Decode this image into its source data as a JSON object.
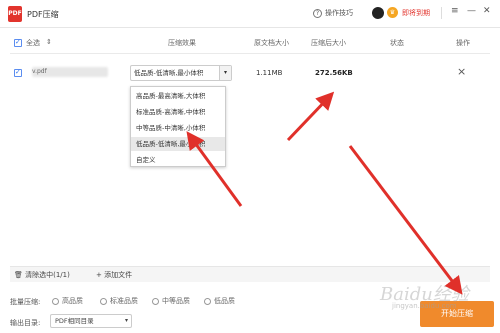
{
  "window": {
    "logo_text": "PDF",
    "title": "PDF压缩",
    "tips": "操作技巧",
    "expire": "即将到期",
    "menu_icon": "≡",
    "min_icon": "—",
    "close_icon": "✕"
  },
  "table": {
    "select_all": "全选",
    "sort_icon": "⇕",
    "headers": [
      "压缩效果",
      "原文档大小",
      "压缩后大小",
      "状态",
      "操作"
    ],
    "row": {
      "filename": "v.pdf",
      "compression": "低品质-低清晰,最小体积",
      "original_size": "1.11MB",
      "compressed_size": "272.56KB",
      "delete": "×"
    },
    "options": [
      "高品质-最高清晰,大体积",
      "标准品质-高清晰,中体积",
      "中等品质-中清晰,小体积",
      "低品质-低清晰,最小体积",
      "自定义"
    ]
  },
  "footer": {
    "clear": "清除选中(1/1)",
    "add": "添加文件"
  },
  "controls": {
    "batch_label": "批量压缩:",
    "radios": [
      "高品质",
      "标准品质",
      "中等品质",
      "低品质"
    ],
    "output_label": "输出目录:",
    "output_value": "PDF相同目录",
    "start_button": "开始压缩"
  },
  "watermark": {
    "main": "Baidu经验",
    "sub": "jingyan.baidu.com"
  },
  "colors": {
    "accent": "#f08a2c",
    "arrow": "#e0302a",
    "expire": "#e2342d"
  }
}
